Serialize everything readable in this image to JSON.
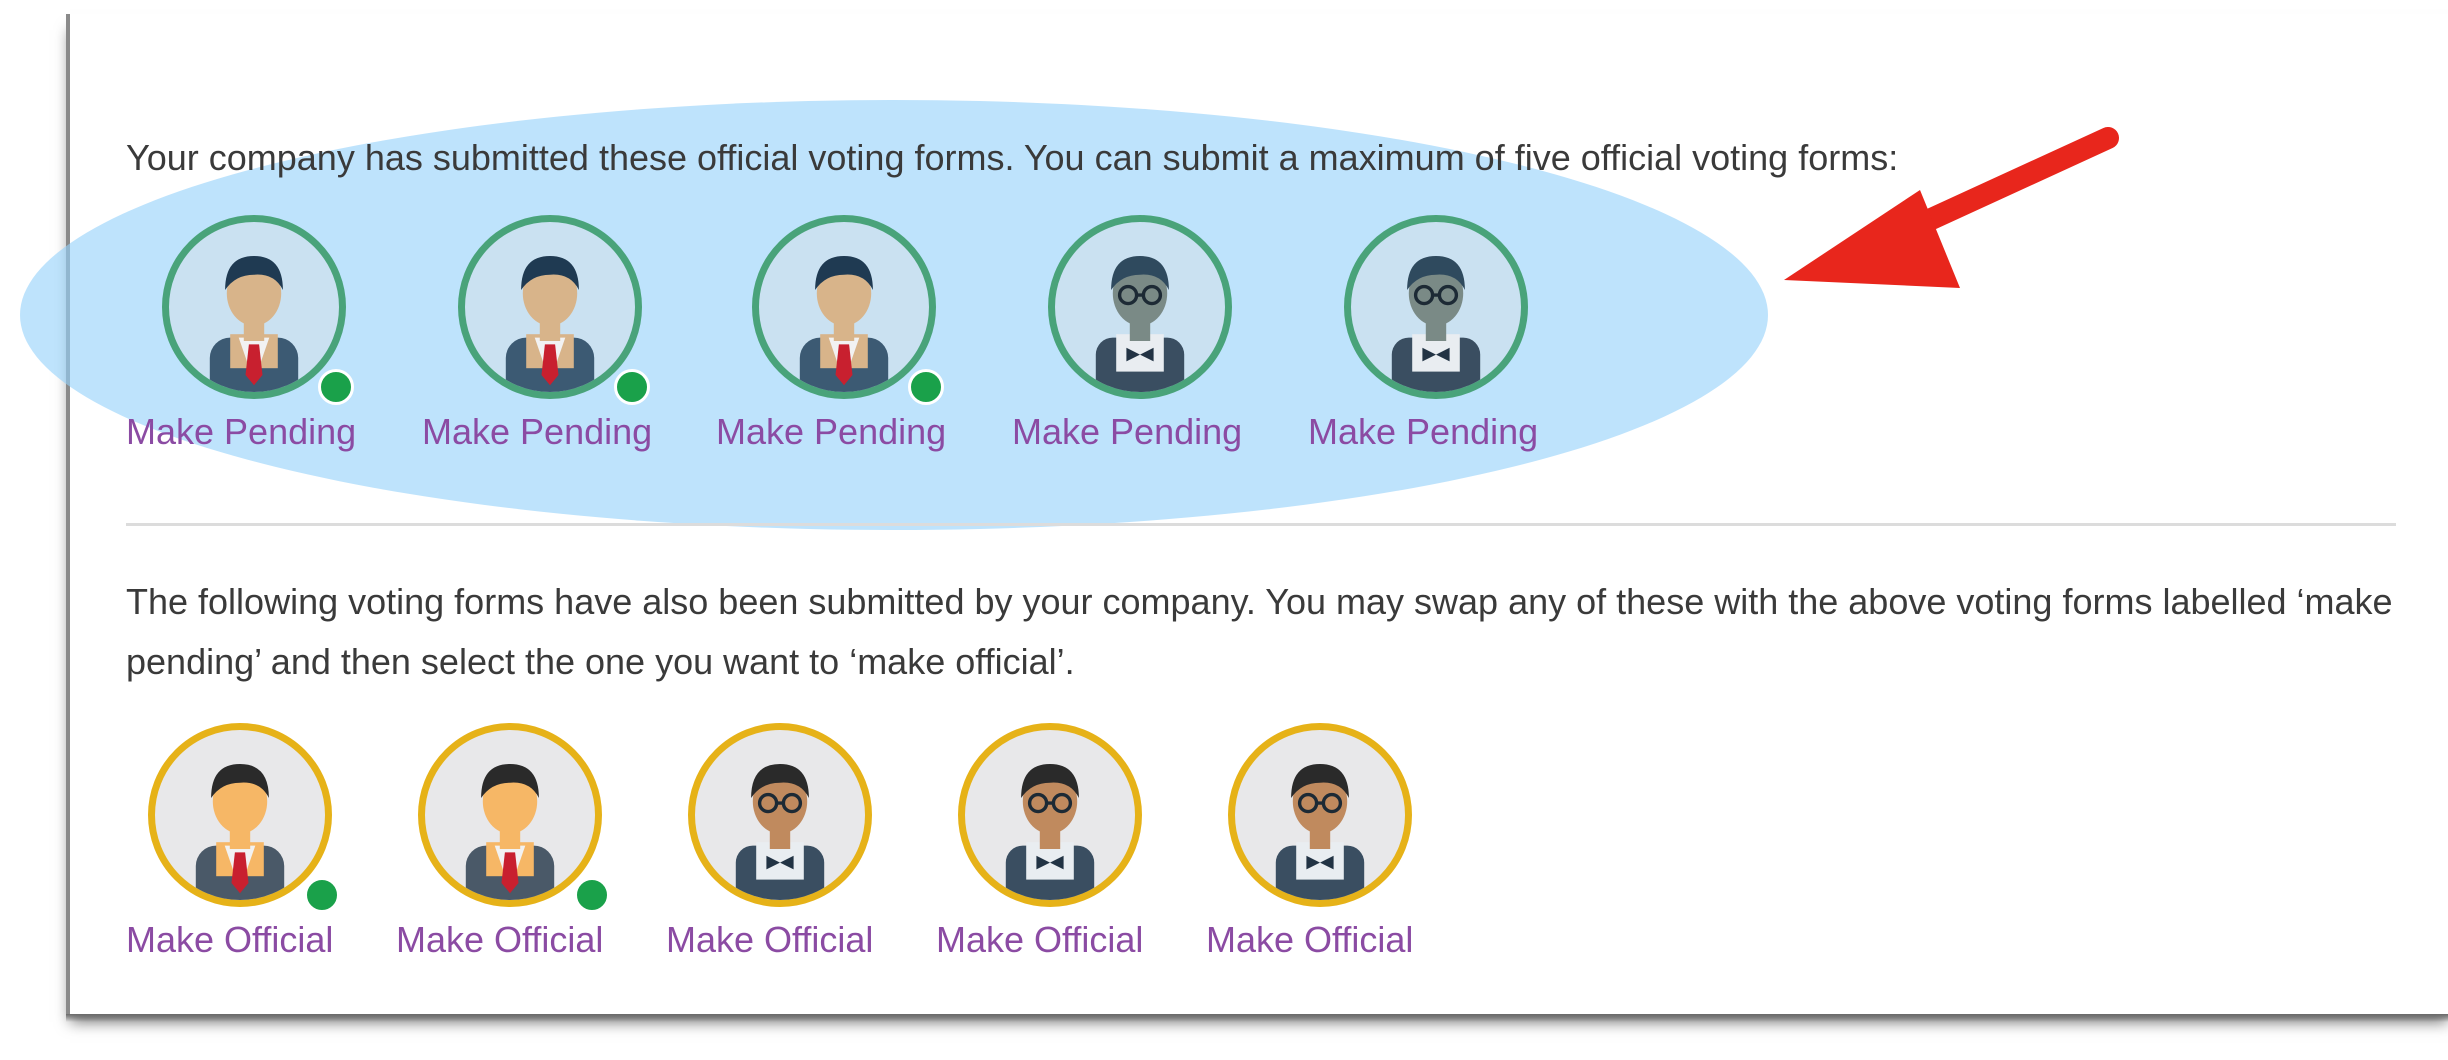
{
  "official_section": {
    "intro_text": "Your company has submitted these official voting forms. You can submit a maximum of five official voting forms:",
    "forms": [
      {
        "avatar_icon": "businessman-tie-icon",
        "online": true,
        "action_label": "Make Pending"
      },
      {
        "avatar_icon": "businessman-tie-icon",
        "online": true,
        "action_label": "Make Pending"
      },
      {
        "avatar_icon": "businessman-tie-icon",
        "online": true,
        "action_label": "Make Pending"
      },
      {
        "avatar_icon": "businessman-glasses-bowtie-icon",
        "online": false,
        "action_label": "Make Pending"
      },
      {
        "avatar_icon": "businessman-glasses-bowtie-icon",
        "online": false,
        "action_label": "Make Pending"
      }
    ]
  },
  "pending_section": {
    "intro_text": "The following voting forms have also been submitted by your company. You may swap any of these with the above voting forms labelled ‘make pending’ and then select the one you want to ‘make official’.",
    "forms": [
      {
        "avatar_icon": "businessman-tie-icon",
        "online": true,
        "action_label": "Make Official"
      },
      {
        "avatar_icon": "businessman-tie-icon",
        "online": true,
        "action_label": "Make Official"
      },
      {
        "avatar_icon": "businessman-glasses-bowtie-icon",
        "online": false,
        "action_label": "Make Official"
      },
      {
        "avatar_icon": "businessman-glasses-bowtie-icon",
        "online": false,
        "action_label": "Make Official"
      },
      {
        "avatar_icon": "businessman-glasses-bowtie-icon",
        "online": false,
        "action_label": "Make Official"
      }
    ]
  },
  "annotations": {
    "highlight_color": "#96d2fa",
    "arrow_color": "#e8261c"
  },
  "colors": {
    "official_ring": "#49a37a",
    "pending_ring": "#e6b218",
    "online_dot": "#1aa14a",
    "link": "#8b4ba3"
  }
}
